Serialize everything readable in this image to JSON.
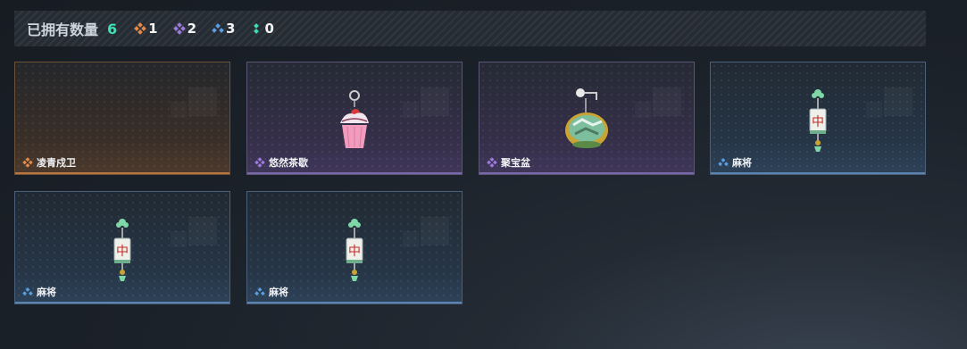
{
  "summary": {
    "title": "已拥有数量",
    "total": "6",
    "counts": [
      {
        "rarity": "orange",
        "value": "1"
      },
      {
        "rarity": "purple",
        "value": "2"
      },
      {
        "rarity": "blue",
        "value": "3"
      },
      {
        "rarity": "green",
        "value": "0"
      }
    ]
  },
  "colors": {
    "orange": "#e5894a",
    "purple": "#9f7ae0",
    "blue": "#5a9ee2",
    "green": "#3ee0b3"
  },
  "cards": [
    {
      "name": "凌青戍卫",
      "rarity": "orange",
      "icon": "empty"
    },
    {
      "name": "悠然茶歇",
      "rarity": "purple",
      "icon": "cupcake-charm-icon"
    },
    {
      "name": "聚宝盆",
      "rarity": "purple",
      "icon": "treasure-bowl-charm-icon"
    },
    {
      "name": "麻将",
      "rarity": "blue",
      "icon": "mahjong-tile-charm-icon"
    },
    {
      "name": "麻将",
      "rarity": "blue",
      "icon": "mahjong-tile-charm-icon"
    },
    {
      "name": "麻将",
      "rarity": "blue",
      "icon": "mahjong-tile-charm-icon"
    }
  ],
  "mahjong_glyph": "中"
}
